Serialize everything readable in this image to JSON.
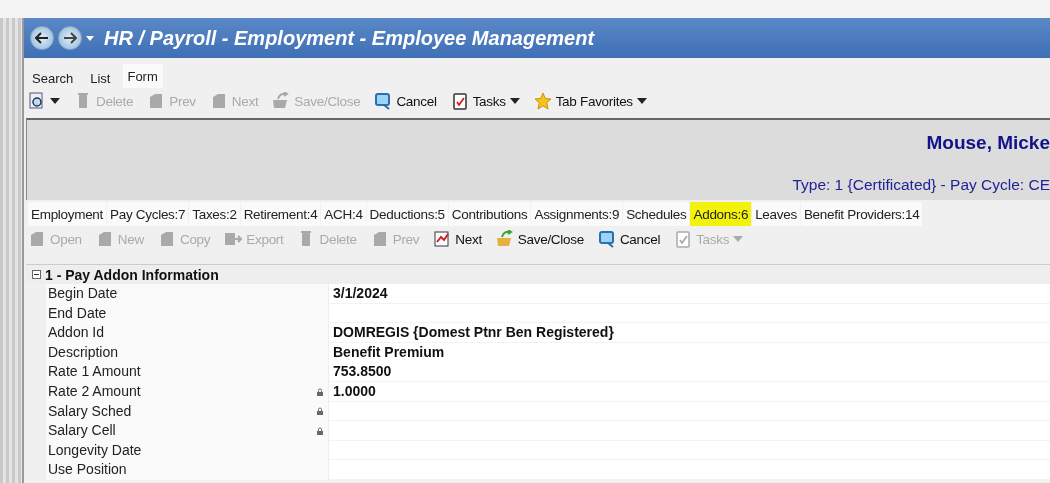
{
  "window": {
    "title": "HR / Payroll - Employment - Employee Management"
  },
  "view_tabs": [
    {
      "label": "Search",
      "selected": false
    },
    {
      "label": "List",
      "selected": false
    },
    {
      "label": "Form",
      "selected": true
    }
  ],
  "toolbar": [
    {
      "kind": "preview",
      "disabled": false,
      "dropdown": true
    },
    {
      "kind": "delete",
      "label": "Delete",
      "disabled": true,
      "dropdown": false
    },
    {
      "kind": "prev",
      "label": "Prev",
      "disabled": true,
      "dropdown": false
    },
    {
      "kind": "next",
      "label": "Next",
      "disabled": true,
      "dropdown": false
    },
    {
      "kind": "save",
      "label": "Save/Close",
      "disabled": true,
      "dropdown": false
    },
    {
      "kind": "cancel",
      "label": "Cancel",
      "disabled": false,
      "dropdown": false
    },
    {
      "kind": "tasks",
      "label": "Tasks",
      "disabled": false,
      "dropdown": true
    },
    {
      "kind": "favorites",
      "label": "Tab Favorites",
      "disabled": false,
      "dropdown": true
    }
  ],
  "header": {
    "name": "Mouse, Micke",
    "subtitle": "Type: 1 {Certificated} - Pay Cycle: CE"
  },
  "record_tabs": [
    {
      "label": "Employment",
      "selected": false
    },
    {
      "label": "Pay Cycles:7",
      "selected": false
    },
    {
      "label": "Taxes:2",
      "selected": false
    },
    {
      "label": "Retirement:4",
      "selected": false
    },
    {
      "label": "ACH:4",
      "selected": false
    },
    {
      "label": "Deductions:5",
      "selected": false
    },
    {
      "label": "Contributions",
      "selected": false
    },
    {
      "label": "Assignments:9",
      "selected": false
    },
    {
      "label": "Schedules",
      "selected": false
    },
    {
      "label": "Addons:6",
      "selected": true
    },
    {
      "label": "Leaves",
      "selected": false
    },
    {
      "label": "Benefit Providers:14",
      "selected": false
    }
  ],
  "record_toolbar": [
    {
      "kind": "open",
      "label": "Open",
      "disabled": true,
      "dropdown": false
    },
    {
      "kind": "new",
      "label": "New",
      "disabled": true,
      "dropdown": false
    },
    {
      "kind": "copy",
      "label": "Copy",
      "disabled": true,
      "dropdown": false
    },
    {
      "kind": "export",
      "label": "Export",
      "disabled": true,
      "dropdown": false
    },
    {
      "kind": "delete",
      "label": "Delete",
      "disabled": true,
      "dropdown": false
    },
    {
      "kind": "prev",
      "label": "Prev",
      "disabled": true,
      "dropdown": false
    },
    {
      "kind": "next",
      "label": "Next",
      "disabled": false,
      "dropdown": false
    },
    {
      "kind": "save",
      "label": "Save/Close",
      "disabled": false,
      "dropdown": false
    },
    {
      "kind": "cancel",
      "label": "Cancel",
      "disabled": false,
      "dropdown": false
    },
    {
      "kind": "tasks",
      "label": "Tasks",
      "disabled": true,
      "dropdown": true
    }
  ],
  "section": {
    "title": "1 - Pay Addon Information",
    "expanded": true,
    "fields": [
      {
        "label": "Begin Date",
        "value": "3/1/2024",
        "locked": false
      },
      {
        "label": "End Date",
        "locked": false
      },
      {
        "label": "Addon Id",
        "value": "DOMREGIS {Domest Ptnr Ben Registered}",
        "locked": false
      },
      {
        "label": "Description",
        "value": "Benefit Premium",
        "locked": false
      },
      {
        "label": "Rate 1 Amount",
        "value": "753.8500",
        "locked": false
      },
      {
        "label": "Rate 2 Amount",
        "value": "1.0000",
        "locked": true
      },
      {
        "label": "Salary Sched",
        "locked": true
      },
      {
        "label": "Salary Cell",
        "locked": true
      },
      {
        "label": "Longevity Date",
        "locked": false
      },
      {
        "label": "Use Position",
        "locked": false
      }
    ]
  }
}
